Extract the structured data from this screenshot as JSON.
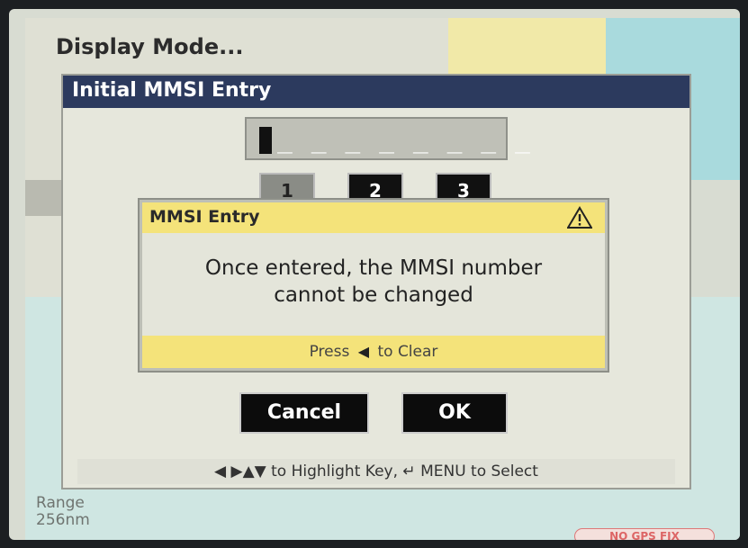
{
  "background": {
    "menu_items": [
      "Display Mode..."
    ],
    "range_label": "Range",
    "range_value": "256nm",
    "gps_status": "NO GPS FIX"
  },
  "main_dialog": {
    "title": "Initial MMSI Entry",
    "input_value": "_ _ _ _ _ _ _ _",
    "keys": [
      "1",
      "2",
      "3"
    ],
    "cancel_label": "Cancel",
    "ok_label": "OK",
    "help_text_arrows": "◀ ▶▲▼",
    "help_text_1": "to Highlight Key,",
    "help_text_enter": "↵",
    "help_text_2": "MENU to Select"
  },
  "alert": {
    "title": "MMSI Entry",
    "icon": "warning-icon",
    "message_line1": "Once entered, the MMSI number",
    "message_line2": "cannot be changed",
    "footer_prefix": "Press",
    "footer_suffix": "to Clear"
  },
  "colors": {
    "title_bar": "#2c3a5e",
    "alert_bar": "#f4e37a",
    "button_bg": "#0c0c0c"
  }
}
